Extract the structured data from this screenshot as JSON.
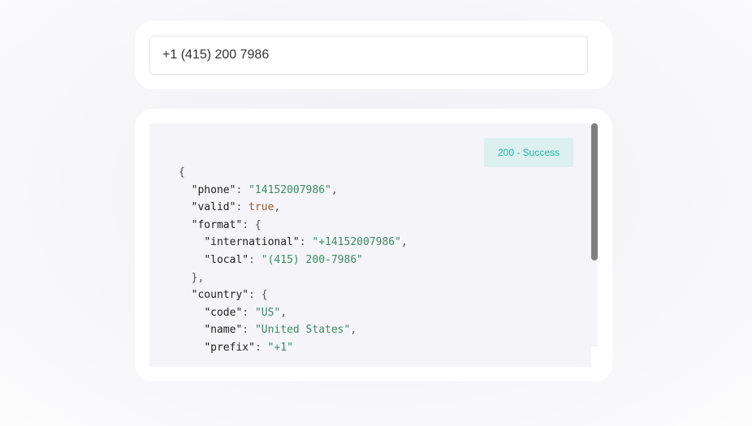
{
  "input": {
    "value": "+1 (415) 200 7986",
    "placeholder": ""
  },
  "response": {
    "status": "200 - Success",
    "json_lines": [
      [
        {
          "t": "p",
          "v": "{"
        }
      ],
      [
        {
          "t": "p",
          "v": "  "
        },
        {
          "t": "k",
          "v": "\"phone\""
        },
        {
          "t": "p",
          "v": ": "
        },
        {
          "t": "s",
          "v": "\"14152007986\""
        },
        {
          "t": "p",
          "v": ","
        }
      ],
      [
        {
          "t": "p",
          "v": "  "
        },
        {
          "t": "k",
          "v": "\"valid\""
        },
        {
          "t": "p",
          "v": ": "
        },
        {
          "t": "b",
          "v": "true"
        },
        {
          "t": "p",
          "v": ","
        }
      ],
      [
        {
          "t": "p",
          "v": "  "
        },
        {
          "t": "k",
          "v": "\"format\""
        },
        {
          "t": "p",
          "v": ": {"
        }
      ],
      [
        {
          "t": "p",
          "v": "    "
        },
        {
          "t": "k",
          "v": "\"international\""
        },
        {
          "t": "p",
          "v": ": "
        },
        {
          "t": "s",
          "v": "\"+14152007986\""
        },
        {
          "t": "p",
          "v": ","
        }
      ],
      [
        {
          "t": "p",
          "v": "    "
        },
        {
          "t": "k",
          "v": "\"local\""
        },
        {
          "t": "p",
          "v": ": "
        },
        {
          "t": "s",
          "v": "\"(415) 200-7986\""
        }
      ],
      [
        {
          "t": "p",
          "v": "  },"
        }
      ],
      [
        {
          "t": "p",
          "v": "  "
        },
        {
          "t": "k",
          "v": "\"country\""
        },
        {
          "t": "p",
          "v": ": {"
        }
      ],
      [
        {
          "t": "p",
          "v": "    "
        },
        {
          "t": "k",
          "v": "\"code\""
        },
        {
          "t": "p",
          "v": ": "
        },
        {
          "t": "s",
          "v": "\"US\""
        },
        {
          "t": "p",
          "v": ","
        }
      ],
      [
        {
          "t": "p",
          "v": "    "
        },
        {
          "t": "k",
          "v": "\"name\""
        },
        {
          "t": "p",
          "v": ": "
        },
        {
          "t": "s",
          "v": "\"United States\""
        },
        {
          "t": "p",
          "v": ","
        }
      ],
      [
        {
          "t": "p",
          "v": "    "
        },
        {
          "t": "k",
          "v": "\"prefix\""
        },
        {
          "t": "p",
          "v": ": "
        },
        {
          "t": "s",
          "v": "\"+1\""
        }
      ]
    ]
  },
  "colors": {
    "json_string": "#3d8b5e",
    "json_boolean": "#9a5b2e",
    "badge_text": "#22b8a5",
    "badge_bg": "#dcf0f0"
  }
}
